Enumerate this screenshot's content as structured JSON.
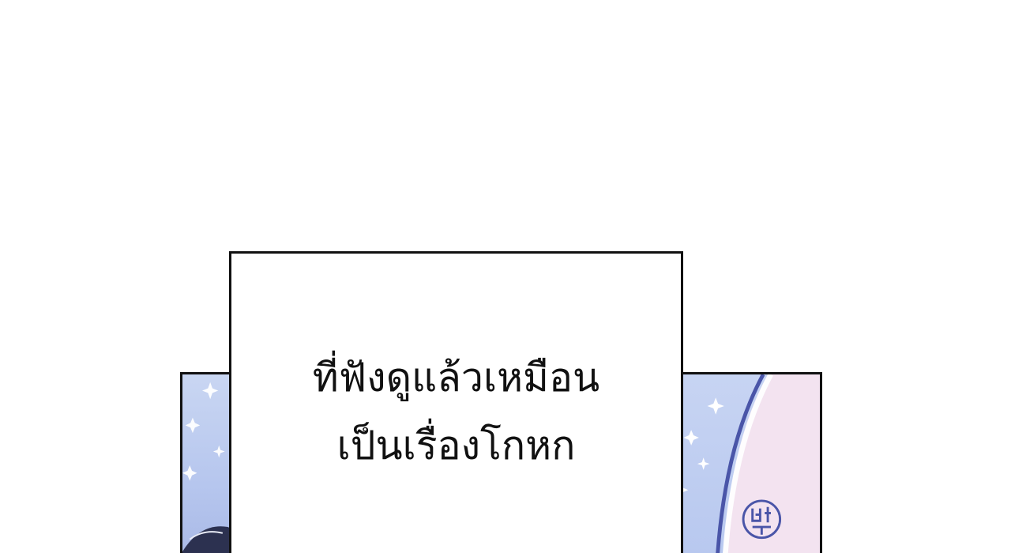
{
  "caption": {
    "line1": "ที่ฟังดูแล้วเหมือน",
    "line2": "เป็นเรื่องโกหก"
  },
  "colors": {
    "panel_border": "#111111",
    "panel_blue": "#b8c8ef",
    "panel_pink": "#f3e3f0",
    "stroke_indigo": "#4a55a8",
    "sparkle": "#ffffff"
  }
}
